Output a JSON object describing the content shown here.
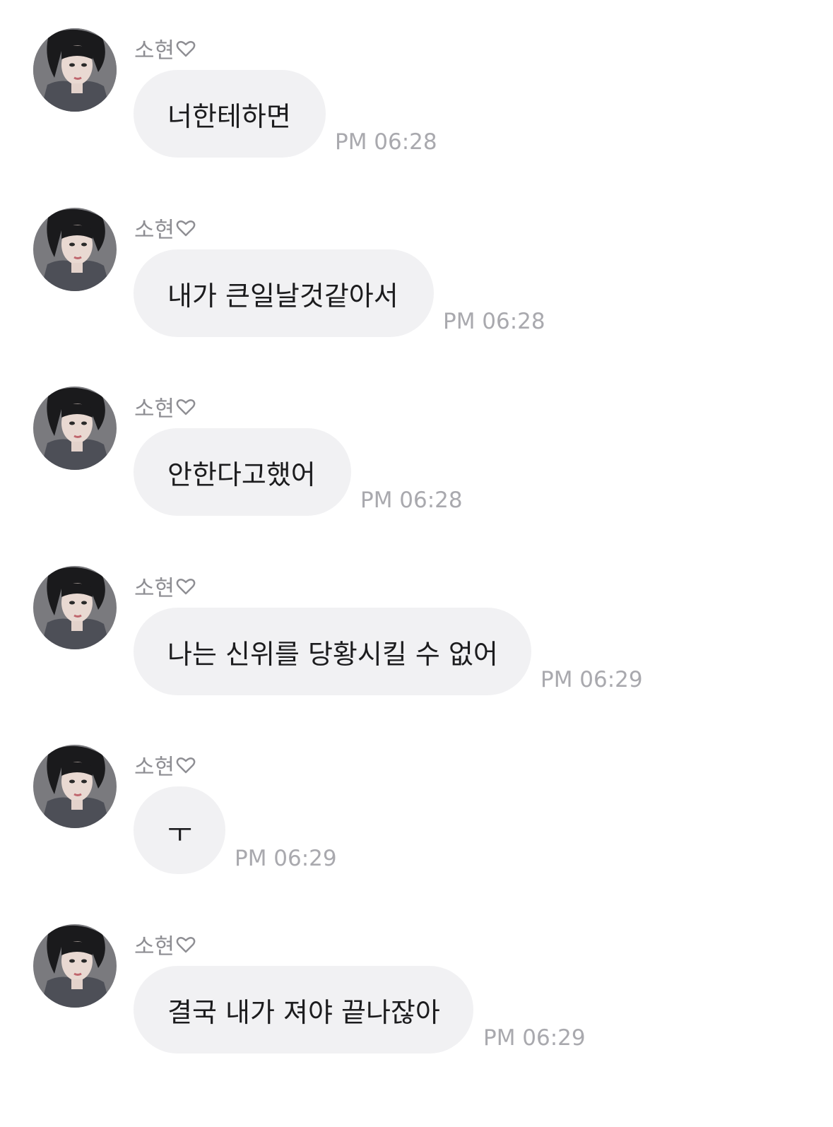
{
  "messages": [
    {
      "sender": "소현",
      "text": "너한테하면",
      "time": "PM 06:28"
    },
    {
      "sender": "소현",
      "text": "내가 큰일날것같아서",
      "time": "PM 06:28"
    },
    {
      "sender": "소현",
      "text": "안한다고했어",
      "time": "PM 06:28"
    },
    {
      "sender": "소현",
      "text": "나는 신위를 당황시킬 수 없어",
      "time": "PM 06:29"
    },
    {
      "sender": "소현",
      "text": "ㅜ",
      "time": "PM 06:29"
    },
    {
      "sender": "소현",
      "text": "결국 내가 져야 끝나잖아",
      "time": "PM 06:29"
    }
  ],
  "colors": {
    "bubble": "#f1f1f3",
    "text": "#1c1c1e",
    "sender": "#8e8e93",
    "time": "#a9a9ae"
  },
  "icons": {
    "sender_suffix": "heart-outline-icon",
    "avatar": "profile-photo"
  }
}
